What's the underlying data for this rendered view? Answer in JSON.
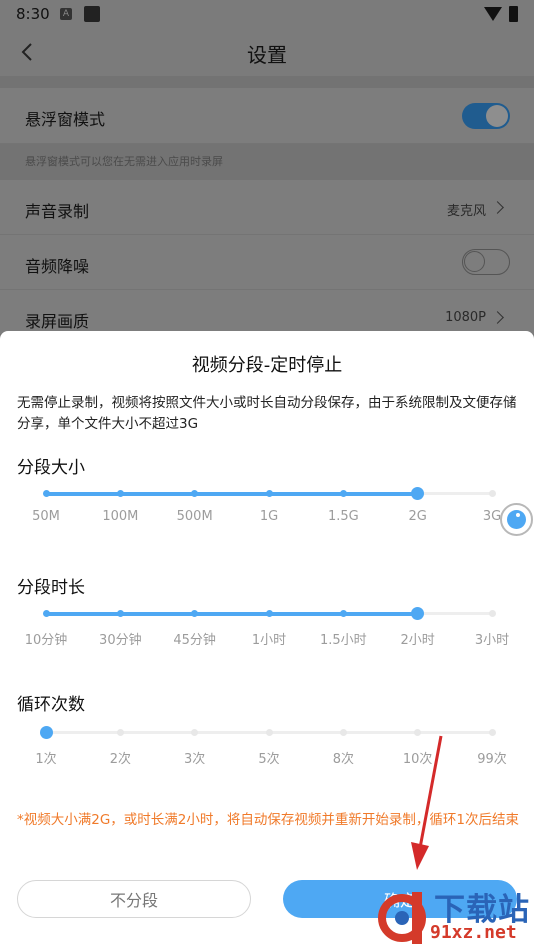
{
  "status_bar": {
    "time": "8:30",
    "a_icon": "A"
  },
  "header": {
    "title": "设置"
  },
  "settings": {
    "float_window": {
      "label": "悬浮窗模式",
      "enabled": true
    },
    "float_hint": "悬浮窗模式可以您在无需进入应用时录屏",
    "audio_record": {
      "label": "声音录制",
      "value": "麦克风"
    },
    "noise_reduce": {
      "label": "音频降噪",
      "enabled": false
    },
    "quality": {
      "label": "录屏画质",
      "value": "1080P"
    }
  },
  "dialog": {
    "title": "视频分段-定时停止",
    "description": "无需停止录制，视频将按照文件大小或时长自动分段保存，由于系统限制及文便存储分享，单个文件大小不超过3G",
    "size_section": {
      "title": "分段大小",
      "options": [
        "50M",
        "100M",
        "500M",
        "1G",
        "1.5G",
        "2G",
        "3G"
      ],
      "selected_index": 5
    },
    "duration_section": {
      "title": "分段时长",
      "options": [
        "10分钟",
        "30分钟",
        "45分钟",
        "1小时",
        "1.5小时",
        "2小时",
        "3小时"
      ],
      "selected_index": 5
    },
    "loop_section": {
      "title": "循环次数",
      "options": [
        "1次",
        "2次",
        "3次",
        "5次",
        "8次",
        "10次",
        "99次"
      ],
      "selected_index": 0
    },
    "note": "*视频大小满2G，或时长满2小时，将自动保存视频并重新开始录制，循环1次后结束",
    "cancel_label": "不分段",
    "ok_label": "确定"
  },
  "watermark": {
    "text1": "下载站",
    "text2": "91xz.net"
  },
  "colors": {
    "accent": "#4ea8f3",
    "note": "#f07a2a",
    "arrow": "#d42a2a"
  }
}
